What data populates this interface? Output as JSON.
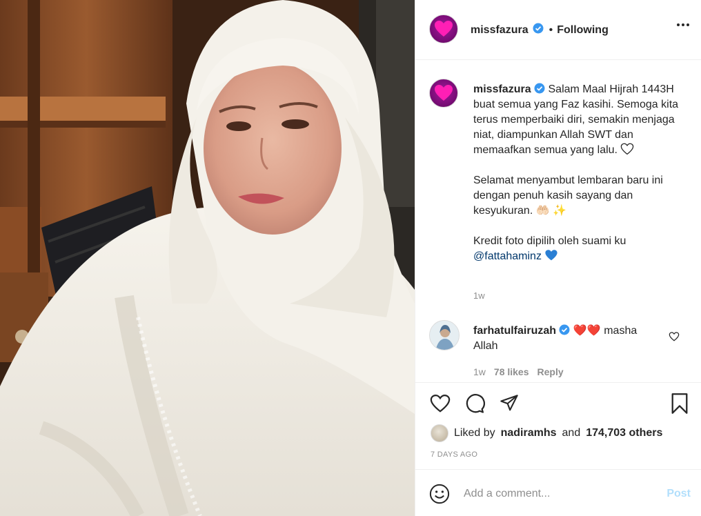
{
  "post": {
    "username": "missfazura",
    "verified": true,
    "follow_status": "Following",
    "separator": "•",
    "icons": {
      "avatar": "heart-avatar-icon",
      "more": "more-options-icon"
    }
  },
  "caption": {
    "username": "missfazura",
    "paragraph_1": "Salam Maal Hijrah 1443H buat semua yang Faz kasihi. Semoga kita terus memperbaiki diri, semakin menjaga niat, diampunkan Allah SWT dan memaafkan semua yang lalu.",
    "paragraph_2": "Selamat menyambut lembaran baru ini dengan penuh kasih sayang dan kesyukuran.",
    "paragraph_2_emoji": "🤲🏻 ✨",
    "paragraph_3": "Kredit foto dipilih oleh suami ku",
    "mention": "@fattahaminz",
    "time": "1w"
  },
  "comment": {
    "username": "farhatulfairuzah",
    "verified": true,
    "emoji": "❤️❤️",
    "text": "masha Allah",
    "time": "1w",
    "likes": "78 likes",
    "reply_label": "Reply"
  },
  "actions": {
    "liked_by_prefix": "Liked by",
    "liked_by_user": "nadiramhs",
    "and_label": "and",
    "others": "174,703 others",
    "posted": "7 DAYS AGO"
  },
  "add_comment": {
    "placeholder": "Add a comment...",
    "post_label": "Post"
  },
  "colors": {
    "text": "#262626",
    "muted": "#8e8e8e",
    "link": "#00376b",
    "verified": "#3897f0",
    "post_disabled": "#b2dffc",
    "avatar": "#7b0d78",
    "heart_red": "#ed4956",
    "heart_blue": "#2a7fd4"
  }
}
